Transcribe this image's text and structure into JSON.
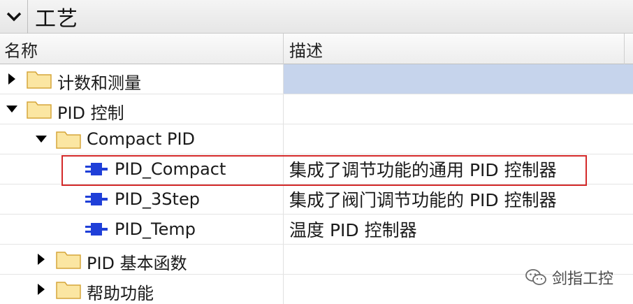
{
  "panel": {
    "title": "工艺"
  },
  "columns": {
    "name": "名称",
    "description": "描述"
  },
  "tree": [
    {
      "label": "计数和测量",
      "description": "",
      "state": "collapsed"
    },
    {
      "label": "PID 控制",
      "description": "",
      "state": "expanded"
    },
    {
      "label": "Compact PID",
      "description": "",
      "state": "expanded"
    },
    {
      "label": "PID_Compact",
      "description": "集成了调节功能的通用 PID 控制器"
    },
    {
      "label": "PID_3Step",
      "description": "集成了阀门调节功能的 PID 控制器"
    },
    {
      "label": "PID_Temp",
      "description": "温度 PID 控制器"
    },
    {
      "label": "PID 基本函数",
      "description": "",
      "state": "collapsed"
    },
    {
      "label": "帮助功能",
      "description": "",
      "state": "collapsed"
    }
  ],
  "watermark": "剑指工控",
  "colors": {
    "selection": "#c6d4ec",
    "highlight_border": "#d42a2a",
    "folder_fill": "#fbe6a2",
    "folder_stroke": "#d6a63a",
    "fb_icon": "#1f3fd8"
  },
  "icons": {
    "collapse": "chevron-down-icon",
    "folder": "folder-icon",
    "function_block": "function-block-icon",
    "expand": "triangle-right-icon",
    "expanded": "triangle-down-icon"
  }
}
